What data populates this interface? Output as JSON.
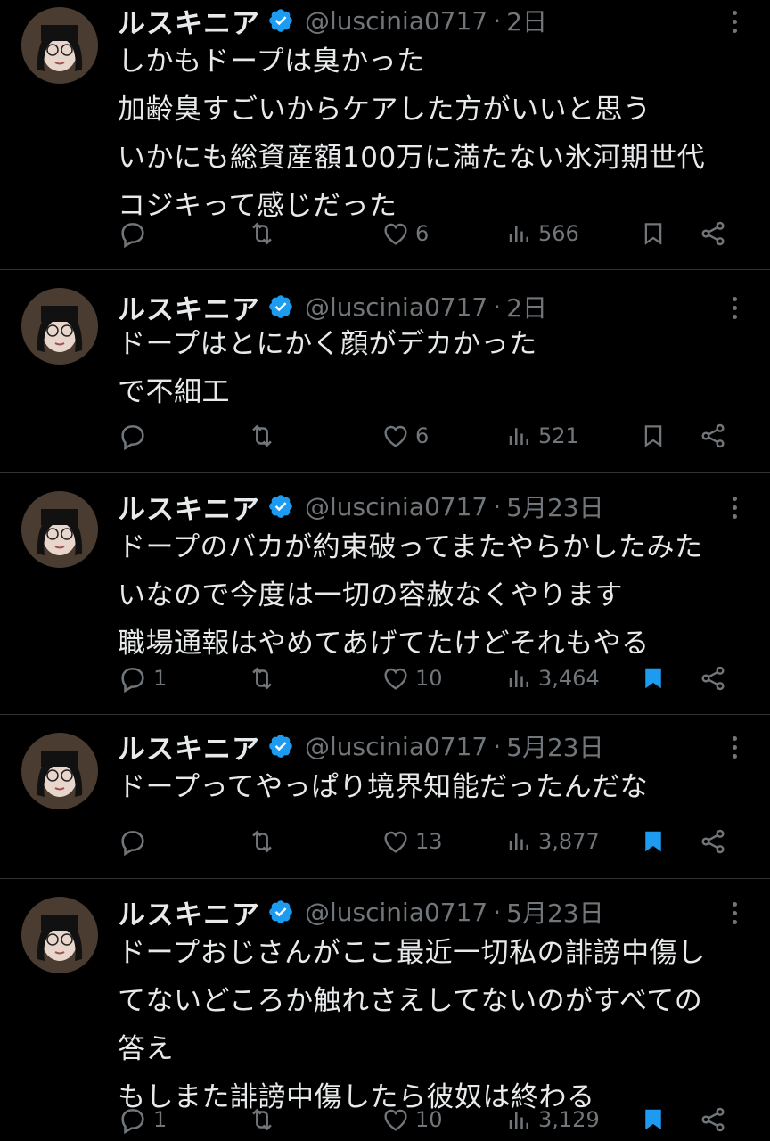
{
  "colors": {
    "background": "#000000",
    "text": "#e7e9ea",
    "muted": "#71767b",
    "accent": "#1d9bf0",
    "divider": "#2f3336"
  },
  "tweets": [
    {
      "name": "ルスキニア",
      "handle": "@luscinia0717",
      "dot": "·",
      "date": "2日",
      "text": "しかもドープは臭かった\n加齢臭すごいからケアした方がいいと思う\nいかにも総資産額100万に満たない氷河期世代\nコジキって感じだった",
      "replies": "",
      "retweets": "",
      "likes": "6",
      "views": "566",
      "bookmarked": false
    },
    {
      "name": "ルスキニア",
      "handle": "@luscinia0717",
      "dot": "·",
      "date": "2日",
      "text": "ドープはとにかく顔がデカかった\nで不細工",
      "replies": "",
      "retweets": "",
      "likes": "6",
      "views": "521",
      "bookmarked": false
    },
    {
      "name": "ルスキニア",
      "handle": "@luscinia0717",
      "dot": "·",
      "date": "5月23日",
      "text": "ドープのバカが約束破ってまたやらかしたみた\nいなので今度は一切の容赦なくやります\n職場通報はやめてあげてたけどそれもやる",
      "replies": "1",
      "retweets": "",
      "likes": "10",
      "views": "3,464",
      "bookmarked": true
    },
    {
      "name": "ルスキニア",
      "handle": "@luscinia0717",
      "dot": "·",
      "date": "5月23日",
      "text": "ドープってやっぱり境界知能だったんだな",
      "replies": "",
      "retweets": "",
      "likes": "13",
      "views": "3,877",
      "bookmarked": true
    },
    {
      "name": "ルスキニア",
      "handle": "@luscinia0717",
      "dot": "·",
      "date": "5月23日",
      "text": "ドープおじさんがここ最近一切私の誹謗中傷し\nてないどころか触れさえしてないのがすべての\n答え\nもしまた誹謗中傷したら彼奴は終わる",
      "replies": "1",
      "retweets": "",
      "likes": "10",
      "views": "3,129",
      "bookmarked": true
    }
  ]
}
